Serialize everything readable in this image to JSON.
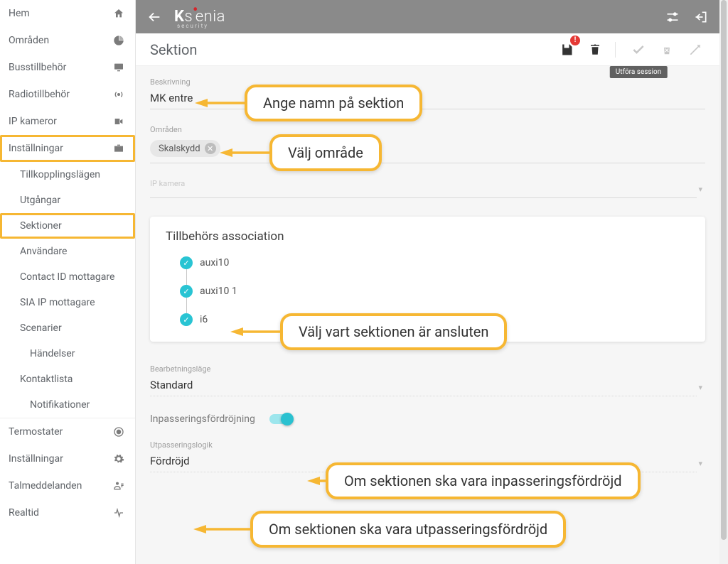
{
  "sidebar": {
    "items": [
      {
        "label": "Hem",
        "icon": "home"
      },
      {
        "label": "Områden",
        "icon": "pie"
      },
      {
        "label": "Busstillbehör",
        "icon": "monitor"
      },
      {
        "label": "Radiotillbehör",
        "icon": "broadcast"
      },
      {
        "label": "IP kameror",
        "icon": "camera"
      },
      {
        "label": "Inställningar",
        "icon": "briefcase",
        "highlighted": true
      },
      {
        "label": "Tillkopplingslägen",
        "sub": true
      },
      {
        "label": "Utgångar",
        "sub": true
      },
      {
        "label": "Sektioner",
        "sub": true,
        "selected": true,
        "highlighted": true
      },
      {
        "label": "Användare",
        "sub": true
      },
      {
        "label": "Contact ID mottagare",
        "sub": true
      },
      {
        "label": "SIA IP mottagare",
        "sub": true
      },
      {
        "label": "Scenarier",
        "sub": true
      },
      {
        "label": "Händelser",
        "sub2": true
      },
      {
        "label": "Kontaktlista",
        "sub": true
      },
      {
        "label": "Notifikationer",
        "sub2": true
      },
      {
        "label": "Termostater",
        "icon": "thermostat"
      },
      {
        "label": "Inställningar",
        "icon": "gear"
      },
      {
        "label": "Talmeddelanden",
        "icon": "voice"
      },
      {
        "label": "Realtid",
        "icon": "activity"
      }
    ]
  },
  "topbar": {
    "brand": "Ksenia",
    "brand_sub": "security"
  },
  "toolbar": {
    "title": "Sektion",
    "save_alert": "!",
    "tooltip_execute": "Utföra session"
  },
  "form": {
    "description_label": "Beskrivning",
    "description_value": "MK entre",
    "areas_label": "Områden",
    "area_chip": "Skalskydd",
    "ipcamera_label": "IP kamera",
    "ipcamera_value": "",
    "association_title": "Tillbehörs association",
    "tree": [
      {
        "label": "auxi10"
      },
      {
        "label": "auxi10 1"
      },
      {
        "label": "i6"
      }
    ],
    "processing_label": "Bearbetningsläge",
    "processing_value": "Standard",
    "entry_delay_label": "Inpasseringsfördröjning",
    "entry_delay_on": true,
    "exit_logic_label": "Utpasseringslogik",
    "exit_logic_value": "Fördröjd"
  },
  "callouts": {
    "name": "Ange namn på sektion",
    "area": "Välj område",
    "assoc": "Välj vart sektionen är ansluten",
    "entry": "Om sektionen ska vara inpasseringsfördröjd",
    "exit": "Om sektionen ska vara utpasseringsfördröjd"
  }
}
